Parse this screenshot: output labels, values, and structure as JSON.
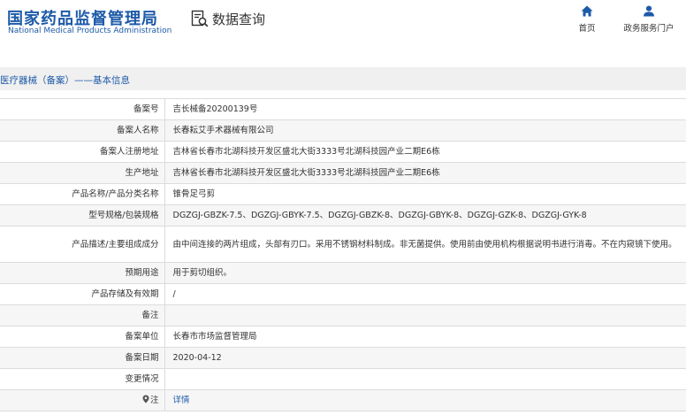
{
  "header": {
    "logo_cn": "国家药品监督管理局",
    "logo_en": "National Medical Products Administration",
    "query_label": "数据查询",
    "nav": [
      {
        "label": "首页",
        "icon": "home-icon"
      },
      {
        "label": "政务服务门户",
        "icon": "user-icon"
      }
    ]
  },
  "colors": {
    "brand": "#1d5aa8",
    "row_alt": "#f6f6f6",
    "crumb_bg": "#f0f0f0"
  },
  "breadcrumb": "医疗器械（备案）——基本信息",
  "rows": [
    {
      "label": "备案号",
      "value": "吉长械备20200139号"
    },
    {
      "label": "备案人名称",
      "value": "长春耘艾手术器械有限公司"
    },
    {
      "label": "备案人注册地址",
      "value": "吉林省长春市北湖科技开发区盛北大街3333号北湖科技园产业二期E6栋"
    },
    {
      "label": "生产地址",
      "value": "吉林省长春市北湖科技开发区盛北大街3333号北湖科技园产业二期E6栋"
    },
    {
      "label": "产品名称/产品分类名称",
      "value": "锥骨足弓剪"
    },
    {
      "label": "型号规格/包装规格",
      "value": "DGZGJ-GBZK-7.5、DGZGJ-GBYK-7.5、DGZGJ-GBZK-8、DGZGJ-GBYK-8、DGZGJ-GZK-8、DGZGJ-GYK-8"
    },
    {
      "label": "产品描述/主要组成成分",
      "value": "由中间连接的两片组成，头部有刃口。采用不锈钢材料制成。非无菌提供。使用前由使用机构根据说明书进行消毒。不在内窥镜下使用。"
    },
    {
      "label": "预期用途",
      "value": "用于剪切组织。"
    },
    {
      "label": "产品存储及有效期",
      "value": "/"
    },
    {
      "label": "备注",
      "value": ""
    },
    {
      "label": "备案单位",
      "value": "长春市市场监督管理局"
    },
    {
      "label": "备案日期",
      "value": "2020-04-12"
    },
    {
      "label": "变更情况",
      "value": ""
    }
  ],
  "note_row": {
    "label": "注",
    "icon": "pin-icon",
    "link": "详情"
  }
}
